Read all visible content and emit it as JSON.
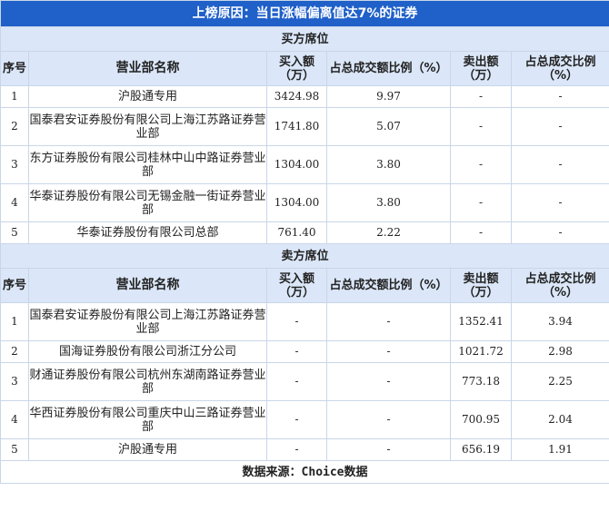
{
  "title": "上榜原因：当日涨幅偏离值达7%的证券",
  "buy": {
    "section_label": "买方席位",
    "headers": [
      "序号",
      "营业部名称",
      "买入额（万）",
      "占总成交额比例（%）",
      "卖出额（万）",
      "占总成交比例（%）"
    ],
    "rows": [
      {
        "no": "1",
        "name": "沪股通专用",
        "buy": "3424.98",
        "buy_pct": "9.97",
        "sell": "-",
        "sell_pct": "-"
      },
      {
        "no": "2",
        "name": "国泰君安证券股份有限公司上海江苏路证券营业部",
        "buy": "1741.80",
        "buy_pct": "5.07",
        "sell": "-",
        "sell_pct": "-"
      },
      {
        "no": "3",
        "name": "东方证券股份有限公司桂林中山中路证券营业部",
        "buy": "1304.00",
        "buy_pct": "3.80",
        "sell": "-",
        "sell_pct": "-"
      },
      {
        "no": "4",
        "name": "华泰证券股份有限公司无锡金融一街证券营业部",
        "buy": "1304.00",
        "buy_pct": "3.80",
        "sell": "-",
        "sell_pct": "-"
      },
      {
        "no": "5",
        "name": "华泰证券股份有限公司总部",
        "buy": "761.40",
        "buy_pct": "2.22",
        "sell": "-",
        "sell_pct": "-"
      }
    ]
  },
  "sell": {
    "section_label": "卖方席位",
    "headers": [
      "序号",
      "营业部名称",
      "买入额（万）",
      "占总成交额比例（%）",
      "卖出额（万）",
      "占总成交比例（%）"
    ],
    "rows": [
      {
        "no": "1",
        "name": "国泰君安证券股份有限公司上海江苏路证券营业部",
        "buy": "-",
        "buy_pct": "-",
        "sell": "1352.41",
        "sell_pct": "3.94"
      },
      {
        "no": "2",
        "name": "国海证券股份有限公司浙江分公司",
        "buy": "-",
        "buy_pct": "-",
        "sell": "1021.72",
        "sell_pct": "2.98"
      },
      {
        "no": "3",
        "name": "财通证券股份有限公司杭州东湖南路证券营业部",
        "buy": "-",
        "buy_pct": "-",
        "sell": "773.18",
        "sell_pct": "2.25"
      },
      {
        "no": "4",
        "name": "华西证券股份有限公司重庆中山三路证券营业部",
        "buy": "-",
        "buy_pct": "-",
        "sell": "700.95",
        "sell_pct": "2.04"
      },
      {
        "no": "5",
        "name": "沪股通专用",
        "buy": "-",
        "buy_pct": "-",
        "sell": "656.19",
        "sell_pct": "1.91"
      }
    ]
  },
  "footer": "数据来源：Choice数据",
  "colors": {
    "title_bg": "#1f60c9",
    "header_bg": "#dbe7f8",
    "border": "#c9d6e8"
  }
}
